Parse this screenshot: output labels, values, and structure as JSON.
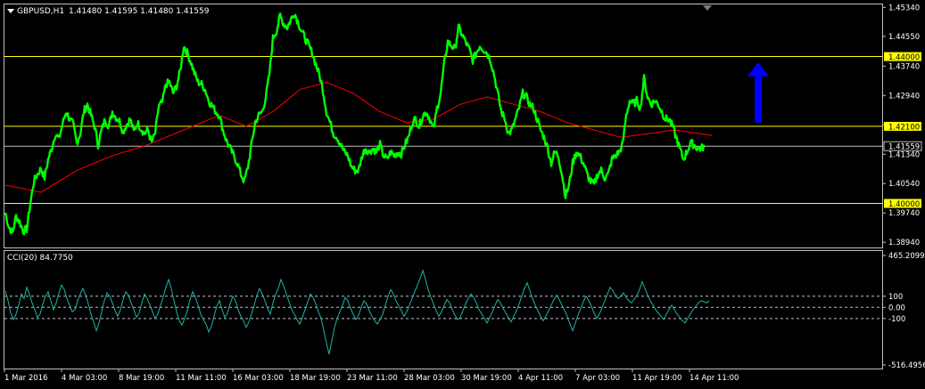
{
  "header": {
    "menu_icon": "triangle-down-icon",
    "symbol": "GBPUSD,H1",
    "ohlc": "1.41480 1.41595 1.41480 1.41559"
  },
  "colors": {
    "background": "#000000",
    "frame": "#c0c0c0",
    "price": "#00ff00",
    "ma": "#ff0000",
    "level": "#ffff00",
    "label_bg": "#ffff00",
    "cci": "#20b2aa",
    "arrow": "#0000ff",
    "text": "#ffffff"
  },
  "chart_data": [
    {
      "type": "line",
      "title": "GBPUSD,H1",
      "y_ticks": [
        "1.45340",
        "1.44550",
        "1.43740",
        "1.42940",
        "1.42140",
        "1.41340",
        "1.40540",
        "1.39740",
        "1.38940"
      ],
      "ylim": [
        1.388,
        1.4542
      ],
      "price_label": "1.41559",
      "current_price": 1.41559,
      "levels": [
        {
          "value": 1.44,
          "label": "1.44000"
        },
        {
          "value": 1.421,
          "label": "1.42100"
        },
        {
          "value": 1.4,
          "label": "1.40000"
        }
      ],
      "x_labels": [
        "1 Mar 2016",
        "4 Mar 03:00",
        "8 Mar 19:00",
        "11 Mar 11:00",
        "16 Mar 03:00",
        "18 Mar 19:00",
        "23 Mar 11:00",
        "28 Mar 03:00",
        "30 Mar 19:00",
        "4 Apr 11:00",
        "7 Apr 03:00",
        "11 Apr 19:00",
        "14 Apr 11:00"
      ],
      "price_series": {
        "x": [
          0,
          4,
          8,
          12,
          16,
          20,
          24,
          28,
          32,
          36,
          40,
          44,
          48,
          52,
          56,
          60,
          64,
          68,
          72,
          76,
          80,
          84,
          88,
          92,
          96,
          100,
          104,
          108,
          112,
          116,
          120,
          124,
          128,
          132,
          136,
          140,
          144,
          148,
          152,
          156,
          160,
          164,
          168,
          172,
          176,
          180,
          184,
          188,
          192,
          196,
          200,
          204,
          208,
          212,
          216,
          220,
          224,
          228,
          232,
          236,
          240,
          244,
          248,
          252,
          256,
          260,
          264,
          268,
          272,
          276,
          280,
          284,
          288,
          292,
          296,
          300,
          304,
          308,
          312,
          316,
          320,
          324,
          328,
          332,
          336,
          340,
          344,
          348,
          352,
          356,
          360,
          364,
          368,
          372,
          376,
          380,
          384,
          388,
          392,
          396,
          400,
          404,
          408,
          412,
          416,
          420,
          424,
          428,
          432,
          436,
          440,
          444,
          448,
          452,
          456,
          460,
          464,
          468,
          472,
          476,
          480,
          484,
          488,
          492,
          496,
          500,
          504,
          508,
          512,
          516,
          520,
          524,
          528,
          532,
          536,
          540,
          544,
          548,
          552,
          556,
          560,
          564,
          568,
          572,
          576,
          580,
          584,
          588,
          592,
          596,
          600,
          604,
          608,
          612,
          616,
          620,
          624,
          628,
          632,
          636,
          640,
          644,
          648,
          652,
          656,
          660,
          664,
          668,
          672,
          676,
          680,
          684,
          688,
          692,
          696,
          700,
          704,
          708,
          712,
          716,
          720,
          724,
          728,
          732,
          736,
          740,
          744,
          748,
          752,
          756,
          760,
          764,
          768,
          772,
          776,
          780,
          784
        ],
        "y": [
          1.3975,
          1.3935,
          1.392,
          1.3965,
          1.395,
          1.3925,
          1.393,
          1.4,
          1.406,
          1.408,
          1.4095,
          1.407,
          1.412,
          1.415,
          1.419,
          1.4175,
          1.4215,
          1.425,
          1.423,
          1.4215,
          1.4165,
          1.419,
          1.425,
          1.427,
          1.424,
          1.421,
          1.416,
          1.42,
          1.423,
          1.421,
          1.425,
          1.4235,
          1.4225,
          1.4195,
          1.4215,
          1.423,
          1.4195,
          1.422,
          1.4205,
          1.419,
          1.42,
          1.4165,
          1.419,
          1.4265,
          1.4275,
          1.4325,
          1.433,
          1.43,
          1.432,
          1.436,
          1.443,
          1.441,
          1.4385,
          1.4355,
          1.433,
          1.4325,
          1.431,
          1.428,
          1.4265,
          1.425,
          1.424,
          1.42,
          1.417,
          1.415,
          1.413,
          1.411,
          1.408,
          1.406,
          1.41,
          1.416,
          1.422,
          1.424,
          1.425,
          1.429,
          1.435,
          1.445,
          1.447,
          1.451,
          1.449,
          1.448,
          1.45,
          1.452,
          1.4495,
          1.447,
          1.445,
          1.443,
          1.441,
          1.438,
          1.435,
          1.431,
          1.425,
          1.422,
          1.419,
          1.418,
          1.416,
          1.414,
          1.413,
          1.41,
          1.409,
          1.409,
          1.413,
          1.415,
          1.414,
          1.415,
          1.414,
          1.416,
          1.413,
          1.412,
          1.414,
          1.413,
          1.414,
          1.4135,
          1.416,
          1.418,
          1.422,
          1.423,
          1.421,
          1.424,
          1.425,
          1.423,
          1.42,
          1.426,
          1.43,
          1.438,
          1.444,
          1.443,
          1.442,
          1.448,
          1.446,
          1.444,
          1.442,
          1.439,
          1.441,
          1.443,
          1.442,
          1.441,
          1.439,
          1.435,
          1.43,
          1.425,
          1.423,
          1.419,
          1.42,
          1.423,
          1.426,
          1.43,
          1.429,
          1.427,
          1.426,
          1.423,
          1.42,
          1.418,
          1.415,
          1.411,
          1.414,
          1.413,
          1.408,
          1.402,
          1.405,
          1.411,
          1.414,
          1.413,
          1.411,
          1.408,
          1.406,
          1.405,
          1.408,
          1.409,
          1.407,
          1.408,
          1.412,
          1.413,
          1.414,
          1.416,
          1.424,
          1.428,
          1.427,
          1.428,
          1.426,
          1.434,
          1.429,
          1.427,
          1.428,
          1.427,
          1.425,
          1.423,
          1.423,
          1.421,
          1.418,
          1.415,
          1.412,
          1.414,
          1.4165,
          1.416,
          1.415,
          1.415,
          1.4156
        ]
      },
      "ma_series": {
        "x": [
          0,
          40,
          80,
          120,
          160,
          200,
          240,
          270,
          300,
          330,
          360,
          390,
          420,
          450,
          480,
          510,
          540,
          570,
          600,
          630,
          660,
          690,
          720,
          750,
          780,
          792
        ],
        "y": [
          1.405,
          1.403,
          1.409,
          1.413,
          1.416,
          1.42,
          1.424,
          1.421,
          1.425,
          1.431,
          1.433,
          1.43,
          1.425,
          1.422,
          1.423,
          1.427,
          1.429,
          1.427,
          1.425,
          1.422,
          1.42,
          1.418,
          1.419,
          1.42,
          1.419,
          1.4185
        ]
      },
      "arrow": {
        "direction": "up",
        "x": 850,
        "y_from": 1.422,
        "y_to": 1.4385
      }
    },
    {
      "type": "line",
      "title": "CCI(20) 84.7750",
      "y_ticks": [
        "465.2099",
        "100",
        "0.00",
        "-100",
        "-516.4956"
      ],
      "ylim": [
        -516.4956,
        465.2099
      ],
      "dashed_levels": [
        100,
        0,
        -100
      ],
      "series": {
        "x": [
          0,
          3,
          6,
          9,
          12,
          15,
          18,
          21,
          24,
          27,
          30,
          33,
          36,
          39,
          42,
          45,
          48,
          51,
          54,
          57,
          60,
          63,
          66,
          69,
          72,
          75,
          78,
          81,
          84,
          87,
          90,
          93,
          96,
          99,
          102,
          105,
          108,
          111,
          114,
          117,
          120,
          123,
          126,
          129,
          132,
          135,
          138,
          141,
          144,
          147,
          150,
          153,
          156,
          159,
          162,
          165,
          168,
          171,
          174,
          177,
          180,
          183,
          186,
          189,
          192,
          195,
          198,
          201,
          204,
          207,
          210,
          213,
          216,
          219,
          222,
          225,
          228,
          231,
          234,
          237,
          240,
          243,
          246,
          249,
          252,
          255,
          258,
          261,
          264,
          267,
          270,
          273,
          276,
          279,
          282,
          285,
          288,
          291,
          294,
          297,
          300,
          303,
          306,
          309,
          312,
          315,
          318,
          321,
          324,
          327,
          330,
          333,
          336,
          339,
          342,
          345,
          348,
          351,
          354,
          357,
          360,
          363,
          366,
          369,
          372,
          375,
          378,
          381,
          384,
          387,
          390,
          393,
          396,
          399,
          402,
          405,
          408,
          411,
          414,
          417,
          420,
          423,
          426,
          429,
          432,
          435,
          438,
          441,
          444,
          447,
          450,
          453,
          456,
          459,
          462,
          465,
          468,
          471,
          474,
          477,
          480,
          483,
          486,
          489,
          492,
          495,
          498,
          501,
          504,
          507,
          510,
          513,
          516,
          519,
          522,
          525,
          528,
          531,
          534,
          537,
          540,
          543,
          546,
          549,
          552,
          555,
          558,
          561,
          564,
          567,
          570,
          573,
          576,
          579,
          582,
          585,
          588,
          591,
          594,
          597,
          600,
          603,
          606,
          609,
          612,
          615,
          618,
          621,
          624,
          627,
          630,
          633,
          636,
          639,
          642,
          645,
          648,
          651,
          654,
          657,
          660,
          663,
          666,
          669,
          672,
          675,
          678,
          681,
          684,
          687,
          690,
          693,
          696,
          699,
          702,
          705,
          708,
          711,
          714,
          717,
          720,
          723,
          726,
          729,
          732,
          735,
          738,
          741,
          744,
          747,
          750,
          753,
          756,
          759,
          762,
          765,
          768,
          771,
          774,
          777,
          780,
          783,
          786,
          789
        ],
        "y": [
          150,
          60,
          -50,
          -110,
          -60,
          20,
          120,
          80,
          180,
          120,
          40,
          -20,
          -90,
          -60,
          30,
          100,
          140,
          60,
          -20,
          40,
          130,
          200,
          160,
          80,
          20,
          -40,
          -20,
          60,
          120,
          170,
          110,
          30,
          -60,
          -130,
          -210,
          -140,
          -40,
          60,
          130,
          100,
          40,
          -30,
          -80,
          -20,
          70,
          140,
          110,
          40,
          -20,
          -90,
          -50,
          40,
          120,
          80,
          20,
          -40,
          -100,
          -60,
          20,
          90,
          180,
          250,
          170,
          60,
          -40,
          -120,
          -160,
          -100,
          -30,
          70,
          140,
          90,
          20,
          -60,
          -110,
          -150,
          -220,
          -170,
          -80,
          10,
          60,
          -20,
          -90,
          -50,
          30,
          100,
          60,
          -20,
          -80,
          -120,
          -180,
          -130,
          -60,
          20,
          110,
          170,
          120,
          60,
          -10,
          -60,
          40,
          120,
          170,
          250,
          190,
          120,
          50,
          -20,
          -60,
          -110,
          -150,
          -90,
          -20,
          50,
          120,
          90,
          30,
          -40,
          -100,
          -210,
          -320,
          -420,
          -300,
          -180,
          -100,
          -40,
          20,
          90,
          60,
          -10,
          -60,
          -110,
          -70,
          0,
          60,
          30,
          -30,
          -80,
          -120,
          -150,
          -110,
          -60,
          20,
          100,
          160,
          120,
          60,
          10,
          -30,
          -80,
          -40,
          20,
          80,
          140,
          200,
          260,
          330,
          250,
          160,
          90,
          30,
          -30,
          -80,
          -40,
          20,
          70,
          40,
          -20,
          -70,
          -110,
          -90,
          -30,
          30,
          80,
          120,
          90,
          40,
          -20,
          -60,
          -100,
          -140,
          -90,
          -40,
          20,
          70,
          40,
          -10,
          -50,
          -90,
          -130,
          -80,
          -30,
          30,
          100,
          170,
          220,
          150,
          80,
          20,
          -30,
          -80,
          -120,
          -80,
          -30,
          20,
          70,
          110,
          70,
          20,
          -30,
          -80,
          -150,
          -210,
          -140,
          -70,
          -10,
          50,
          100,
          60,
          10,
          -50,
          -100,
          -60,
          0,
          60,
          120,
          180,
          150,
          110,
          80,
          100,
          130,
          90,
          60,
          40,
          70,
          110,
          160,
          230,
          170,
          110,
          60,
          20,
          -20,
          -50,
          -80,
          -110,
          -60,
          -20,
          20,
          -20,
          -60,
          -90,
          -120,
          -140,
          -100,
          -60,
          -20,
          10,
          40,
          60,
          50,
          40,
          60,
          85
        ]
      }
    }
  ]
}
